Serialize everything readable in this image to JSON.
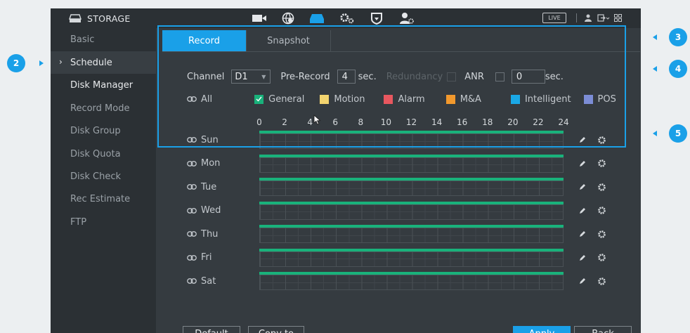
{
  "header": {
    "title": "STORAGE",
    "nav_icons": [
      "camera-icon",
      "network-icon",
      "storage-icon",
      "settings-icon",
      "shield-icon",
      "account-icon"
    ],
    "live_label": "LIVE"
  },
  "sidebar": {
    "items": [
      {
        "label": "Basic"
      },
      {
        "label": "Schedule"
      },
      {
        "label": "Disk Manager"
      },
      {
        "label": "Record Mode"
      },
      {
        "label": "Disk Group"
      },
      {
        "label": "Disk Quota"
      },
      {
        "label": "Disk Check"
      },
      {
        "label": "Rec Estimate"
      },
      {
        "label": "FTP"
      }
    ],
    "selected": "Schedule"
  },
  "tabs": [
    {
      "label": "Record",
      "active": true
    },
    {
      "label": "Snapshot",
      "active": false
    }
  ],
  "controls": {
    "channel_label": "Channel",
    "channel_value": "D1",
    "prerecord_label": "Pre-Record",
    "prerecord_value": "4",
    "sec_label": "sec.",
    "redundancy_label": "Redundancy",
    "anr_label": "ANR",
    "anr_value": "0",
    "anr_sec_label": "sec."
  },
  "legend": {
    "all_label": "All",
    "items": [
      {
        "label": "General",
        "color": "#19b27b",
        "checked": true
      },
      {
        "label": "Motion",
        "color": "#f3d46f"
      },
      {
        "label": "Alarm",
        "color": "#e8575f"
      },
      {
        "label": "M&A",
        "color": "#f2992d"
      },
      {
        "label": "Intelligent",
        "color": "#1aa8e6"
      },
      {
        "label": "POS",
        "color": "#7c8dd6"
      }
    ]
  },
  "hours": [
    "0",
    "2",
    "4",
    "6",
    "8",
    "10",
    "12",
    "14",
    "16",
    "18",
    "20",
    "22",
    "24"
  ],
  "days": [
    "Sun",
    "Mon",
    "Tue",
    "Wed",
    "Thu",
    "Fri",
    "Sat"
  ],
  "buttons": {
    "default": "Default",
    "copy_to": "Copy to",
    "apply": "Apply",
    "back": "Back"
  },
  "callouts": [
    "2",
    "3",
    "4",
    "5"
  ],
  "colors": {
    "accent": "#1aa0e8",
    "record_bar": "#19b27b"
  }
}
